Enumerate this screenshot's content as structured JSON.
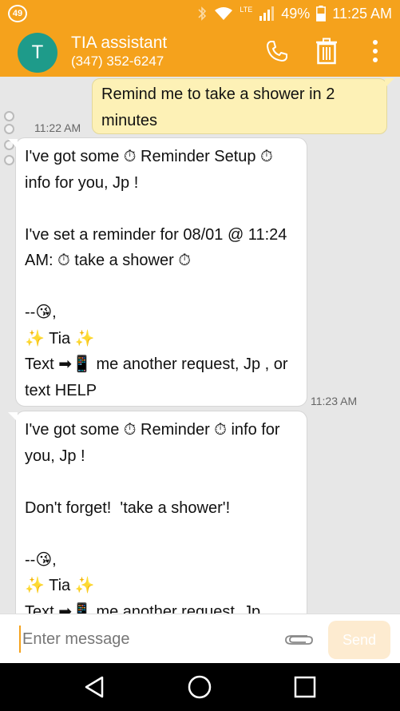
{
  "status_bar": {
    "notification_count": "49",
    "battery_percent": "49%",
    "time": "11:25 AM",
    "icons": [
      "bluetooth-icon",
      "wifi-icon",
      "lte-icon",
      "signal-icon",
      "battery-icon"
    ],
    "lte_label": "LTE"
  },
  "app_bar": {
    "avatar_letter": "T",
    "contact_name": "TIA assistant",
    "contact_phone": "(347) 352-6247",
    "actions": [
      "phone-icon",
      "delete-icon",
      "more-icon"
    ]
  },
  "messages": [
    {
      "direction": "outgoing",
      "text": "Remind me to take a shower in 2 minutes",
      "time": "11:22 AM"
    },
    {
      "direction": "incoming",
      "text": "I've got some ⏱ Reminder Setup ⏱ info for you, Jp !\n\nI've set a reminder for 08/01 @ 11:24 AM: ⏱ take a shower ⏱\n\n--😘,\n✨ Tia ✨\nText ➡📱 me another request, Jp , or text HELP",
      "time": "11:23 AM"
    },
    {
      "direction": "incoming",
      "text": "I've got some ⏱ Reminder ⏱ info for you, Jp !\n\nDon't forget!  'take a shower'!\n\n--😘,\n✨ Tia ✨\nText ➡📱 me another request, Jp",
      "time": ""
    }
  ],
  "compose": {
    "placeholder": "Enter message",
    "send_label": "Send"
  },
  "colors": {
    "accent": "#f5a21c",
    "avatar": "#1e9b8a",
    "outgoing_bubble": "#fdf1b6",
    "incoming_bubble": "#ffffff",
    "background": "#e7e7e7"
  },
  "nav_bar": [
    "back-icon",
    "home-icon",
    "recents-icon"
  ]
}
